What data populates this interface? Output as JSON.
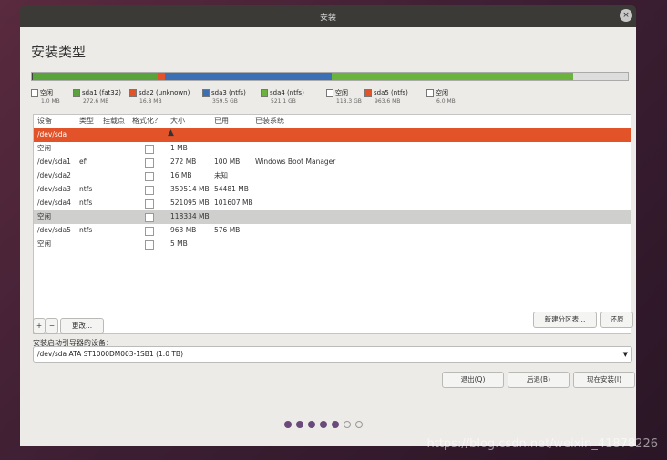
{
  "window": {
    "title": "安装",
    "close_glyph": "×"
  },
  "page_title": "安装类型",
  "disk_segments": [
    {
      "name": "空闲",
      "color": "#3f3f3f",
      "fraction": 0.001
    },
    {
      "name": "sda1 (fat32)",
      "color": "#58a33a",
      "fraction": 0.27
    },
    {
      "name": "sda2 (unknown)",
      "color": "#e2532a",
      "fraction": 0.017
    },
    {
      "name": "sda3 (ntfs)",
      "color": "#3d6fb4",
      "fraction": 0.36
    },
    {
      "name": "sda4 (ntfs)",
      "color": "#6ab33d",
      "fraction": 0.521
    },
    {
      "name": "空闲",
      "color": "#dddddd",
      "fraction": 0.118
    }
  ],
  "legend": [
    {
      "label": "空闲",
      "size": "1.0 MB",
      "color": "#ffffff"
    },
    {
      "label": "sda1 (fat32)",
      "size": "272.6 MB",
      "color": "#58a33a"
    },
    {
      "label": "sda2 (unknown)",
      "size": "16.8 MB",
      "color": "#e2532a"
    },
    {
      "label": "sda3 (ntfs)",
      "size": "359.5 GB",
      "color": "#3d6fb4"
    },
    {
      "label": "sda4 (ntfs)",
      "size": "521.1 GB",
      "color": "#6ab33d"
    },
    {
      "label": "空闲",
      "size": "118.3 GB",
      "color": "#ffffff"
    },
    {
      "label": "sda5 (ntfs)",
      "size": "963.6 MB",
      "color": "#e2532a"
    },
    {
      "label": "空闲",
      "size": "6.0 MB",
      "color": "#ffffff"
    }
  ],
  "table": {
    "headers": {
      "device": "设备",
      "type": "类型",
      "mount": "挂载点",
      "format": "格式化？",
      "size": "大小",
      "used": "已用",
      "system": "已装系统"
    },
    "rows": [
      {
        "device": "/dev/sda",
        "type": "",
        "size": "",
        "used": "",
        "system": "",
        "check": false
      },
      {
        "device": "空闲",
        "type": "",
        "size": "1 MB",
        "used": "",
        "system": "",
        "check": true
      },
      {
        "device": "/dev/sda1",
        "type": "efi",
        "size": "272 MB",
        "used": "100 MB",
        "system": "Windows Boot Manager",
        "check": true
      },
      {
        "device": "/dev/sda2",
        "type": "",
        "size": "16 MB",
        "used": "未知",
        "system": "",
        "check": true
      },
      {
        "device": "/dev/sda3",
        "type": "ntfs",
        "size": "359514 MB",
        "used": "54481 MB",
        "system": "",
        "check": true
      },
      {
        "device": "/dev/sda4",
        "type": "ntfs",
        "size": "521095 MB",
        "used": "101607 MB",
        "system": "",
        "check": true
      },
      {
        "device": "空闲",
        "type": "",
        "size": "118334 MB",
        "used": "",
        "system": "",
        "check": true
      },
      {
        "device": "/dev/sda5",
        "type": "ntfs",
        "size": "963 MB",
        "used": "576 MB",
        "system": "",
        "check": true
      },
      {
        "device": "空闲",
        "type": "",
        "size": "5 MB",
        "used": "",
        "system": "",
        "check": true
      }
    ]
  },
  "buttons": {
    "add": "+",
    "remove": "−",
    "change": "更改...",
    "new_table": "新建分区表...",
    "revert": "还原",
    "quit": "退出(Q)",
    "back": "后退(B)",
    "install_now": "现在安装(I)"
  },
  "boot_device": {
    "label": "安装启动引导器的设备：",
    "value": "/dev/sda   ATA ST1000DM003-1SB1 (1.0 TB)"
  },
  "progress_dots": {
    "total": 7,
    "active": 5
  },
  "watermark": "https://blog.csdn.net/weixin_41878226"
}
